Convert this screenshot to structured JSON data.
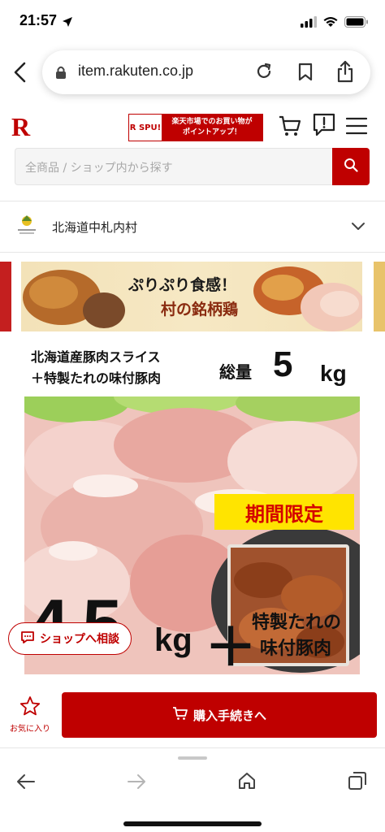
{
  "status": {
    "time": "21:57"
  },
  "browser": {
    "url": "item.rakuten.co.jp"
  },
  "header": {
    "logo": "R",
    "spu_badge": "R SPU!",
    "spu_text_line1": "楽天市場でのお買い物が",
    "spu_text_line2": "ポイントアップ！"
  },
  "search": {
    "placeholder": "全商品 / ショップ内から探す"
  },
  "shop": {
    "name": "北海道中札内村"
  },
  "banner": {
    "line1": "ぷりぷり食感！",
    "line2": "村の銘柄鶏"
  },
  "product": {
    "title_line1": "北海道産豚肉スライス",
    "title_line2": "＋特製たれの味付豚肉",
    "total_label": "総量",
    "total_value": "5",
    "total_unit": "kg",
    "limited": "期間限定",
    "big_amount": "4.5",
    "big_unit": "kg",
    "plus": "＋",
    "sauce_line1": "特製たれの",
    "sauce_line2": "味付豚肉"
  },
  "consult": {
    "label": "ショップへ相談"
  },
  "purchase": {
    "favorite_label": "お気に入り",
    "buy_label": "購入手続きへ"
  },
  "colors": {
    "brand": "#bf0000",
    "limited_bg": "#ffe400"
  },
  "icons": [
    "location-arrow-icon",
    "signal-icon",
    "wifi-icon",
    "battery-icon",
    "back-icon",
    "lock-icon",
    "reload-icon",
    "bookmark-icon",
    "share-icon",
    "cart-icon",
    "chat-icon",
    "menu-icon",
    "search-icon",
    "chevron-down-icon",
    "chat-bubble-icon",
    "star-icon",
    "forward-icon",
    "home-icon",
    "tabs-icon"
  ]
}
